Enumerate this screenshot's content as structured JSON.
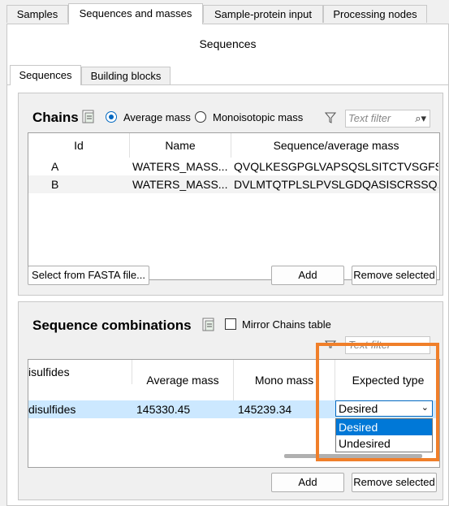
{
  "top_tabs": [
    "Samples",
    "Sequences and masses",
    "Sample-protein input",
    "Processing nodes"
  ],
  "page_title": "Sequences",
  "sub_tabs": [
    "Sequences",
    "Building blocks"
  ],
  "chains": {
    "title": "Chains",
    "radio_average": "Average mass",
    "radio_mono": "Monoisotopic mass",
    "filter_placeholder": "Text filter",
    "columns": [
      "Id",
      "Name",
      "Sequence/average mass"
    ],
    "rows": [
      {
        "id": "A",
        "name": "WATERS_MASS...",
        "seq": "QVQLKESGPGLVAPSQSLSITCTVSGFS..."
      },
      {
        "id": "B",
        "name": "WATERS_MASS...",
        "seq": "DVLMTQTPLSLPVSLGDQASISCRSSQ..."
      }
    ],
    "btn_fasta": "Select from FASTA file...",
    "btn_add": "Add",
    "btn_remove": "Remove selected"
  },
  "combos": {
    "title": "Sequence combinations",
    "mirror_label": "Mirror Chains table",
    "filter_placeholder": "Text filter",
    "columns": [
      "isulfides",
      "Average mass",
      "Mono mass",
      "Expected type"
    ],
    "row": {
      "disulfides": "disulfides",
      "avg": "145330.45",
      "mono": "145239.34",
      "type": "Desired"
    },
    "dropdown_options": [
      "Desired",
      "Undesired"
    ],
    "btn_add": "Add",
    "btn_remove": "Remove selected"
  },
  "colors": {
    "highlight": "#f07f2a",
    "selection": "#cce8ff",
    "accent": "#0067c0"
  }
}
